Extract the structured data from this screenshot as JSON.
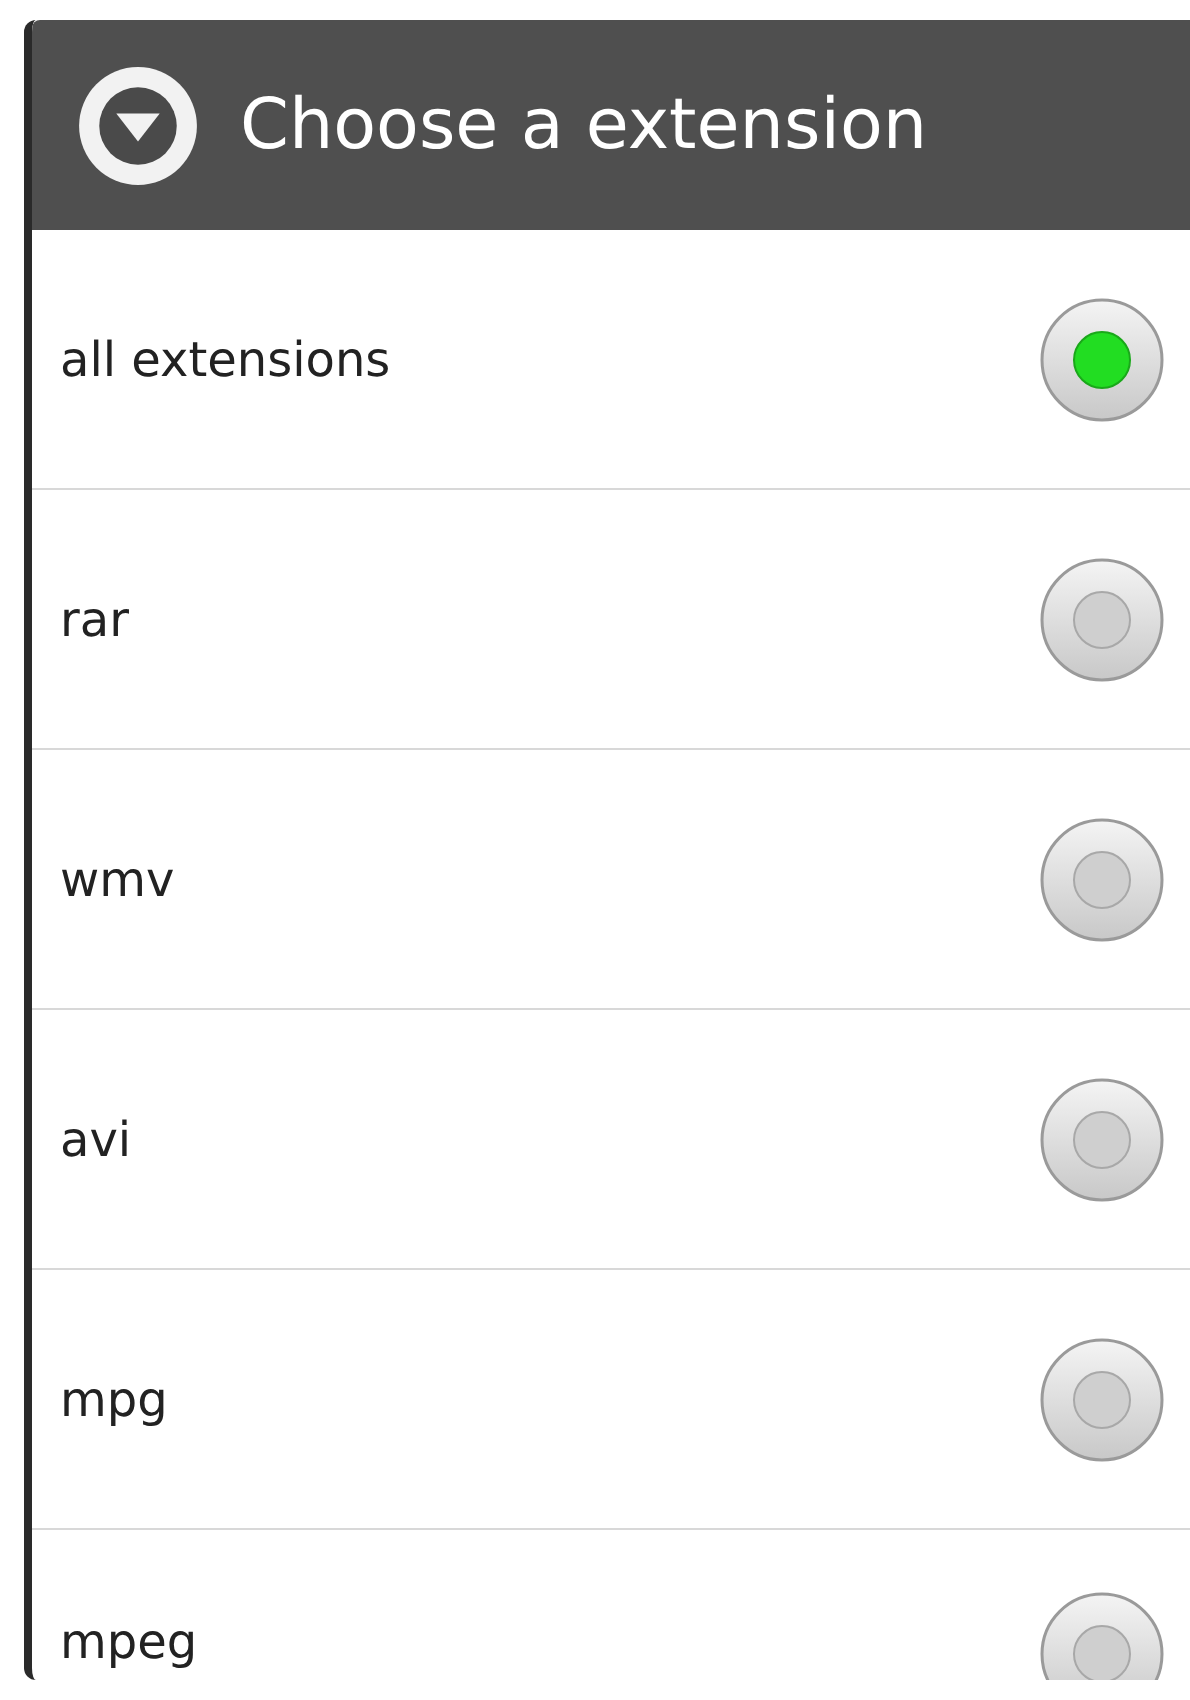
{
  "dialog": {
    "title": "Choose a extension",
    "options": [
      {
        "label": "all extensions",
        "selected": true
      },
      {
        "label": "rar",
        "selected": false
      },
      {
        "label": "wmv",
        "selected": false
      },
      {
        "label": "avi",
        "selected": false
      },
      {
        "label": "mpg",
        "selected": false
      },
      {
        "label": "mpeg",
        "selected": false
      }
    ]
  }
}
